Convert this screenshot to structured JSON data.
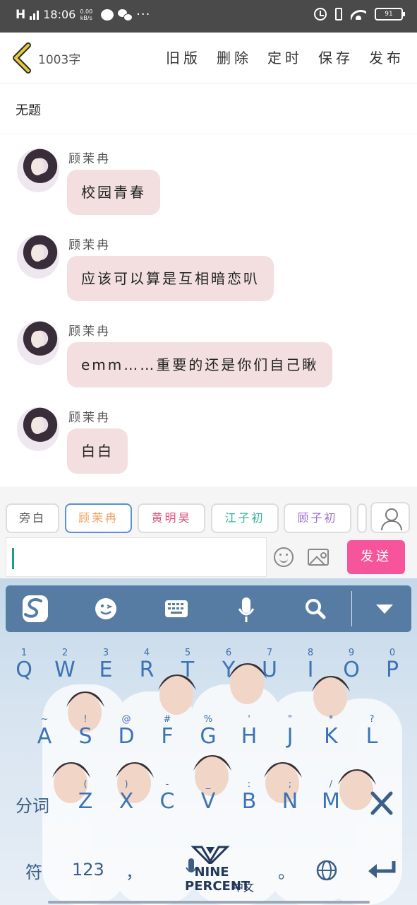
{
  "status_bar": {
    "signal_label": "H",
    "time": "18:06",
    "speed_value": "0.00",
    "speed_unit": "kB/s",
    "more_dots": "···",
    "battery_level": "91"
  },
  "header": {
    "word_count": "1003字",
    "actions": [
      "旧版",
      "删除",
      "定时",
      "保存",
      "发布"
    ]
  },
  "document": {
    "title": "无题"
  },
  "messages": [
    {
      "sender": "顾茉冉",
      "text": "校园青春"
    },
    {
      "sender": "顾茉冉",
      "text": "应该可以算是互相暗恋叭"
    },
    {
      "sender": "顾茉冉",
      "text": "emm……重要的还是你们自己瞅"
    },
    {
      "sender": "顾茉冉",
      "text": "白白"
    }
  ],
  "characters": [
    {
      "name": "旁白",
      "color": "#555555",
      "selected": false
    },
    {
      "name": "顾茉冉",
      "color": "#f0a060",
      "selected": true
    },
    {
      "name": "黄明昊",
      "color": "#e0507a",
      "selected": false
    },
    {
      "name": "江子初",
      "color": "#2fb39d",
      "selected": false
    },
    {
      "name": "顾子初",
      "color": "#9a6fd0",
      "selected": false
    }
  ],
  "composer": {
    "send_label": "发送"
  },
  "keyboard": {
    "row1": [
      {
        "hint": "1",
        "key": "Q"
      },
      {
        "hint": "2",
        "key": "W"
      },
      {
        "hint": "3",
        "key": "E"
      },
      {
        "hint": "4",
        "key": "R"
      },
      {
        "hint": "5",
        "key": "T"
      },
      {
        "hint": "6",
        "key": "Y"
      },
      {
        "hint": "7",
        "key": "U"
      },
      {
        "hint": "8",
        "key": "I"
      },
      {
        "hint": "9",
        "key": "O"
      },
      {
        "hint": "0",
        "key": "P"
      }
    ],
    "row2": [
      {
        "hint": "~",
        "key": "A"
      },
      {
        "hint": "!",
        "key": "S"
      },
      {
        "hint": "@",
        "key": "D"
      },
      {
        "hint": "#",
        "key": "F"
      },
      {
        "hint": "%",
        "key": "G"
      },
      {
        "hint": "'",
        "key": "H"
      },
      {
        "hint": "\"",
        "key": "J"
      },
      {
        "hint": "*",
        "key": "K"
      },
      {
        "hint": "?",
        "key": "L"
      }
    ],
    "row3": [
      {
        "hint": "(",
        "key": "Z"
      },
      {
        "hint": ")",
        "key": "X"
      },
      {
        "hint": "-",
        "key": "C"
      },
      {
        "hint": "_",
        "key": "V"
      },
      {
        "hint": ":",
        "key": "B"
      },
      {
        "hint": ";",
        "key": "N"
      },
      {
        "hint": "/",
        "key": "M"
      }
    ],
    "segment_key": "分词",
    "symbol_key": "符",
    "number_key": "123",
    "comma_key": "，",
    "period_key": "。",
    "brand_text": "NINE PERCENT",
    "brand_cn": "中文",
    "accent_color": "#3b73b5"
  }
}
